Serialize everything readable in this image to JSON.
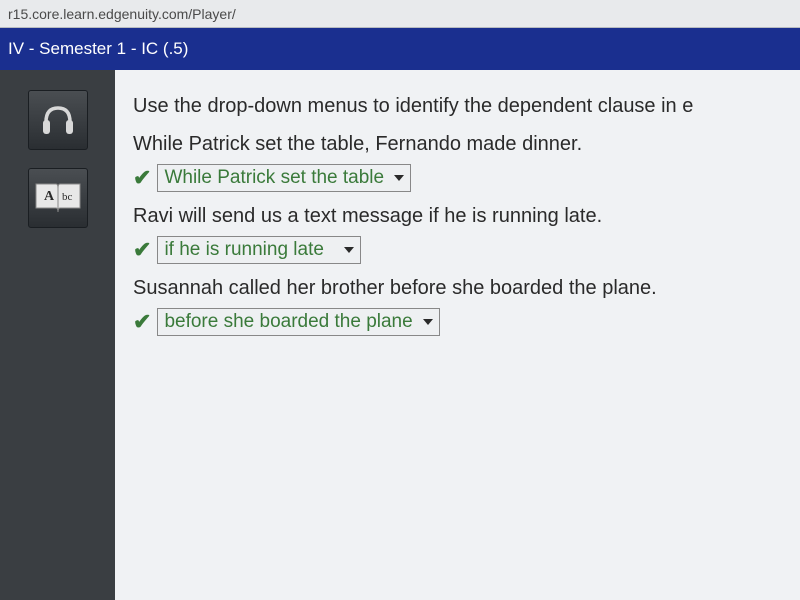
{
  "address_bar": {
    "url": "r15.core.learn.edgenuity.com/Player/"
  },
  "course_header": {
    "title": "IV - Semester 1 - IC (.5)"
  },
  "sidebar": {
    "audio_btn": "headphones-icon",
    "glossary_btn": "glossary-icon"
  },
  "content": {
    "instruction": "Use the drop-down menus to identify the dependent clause in e",
    "questions": [
      {
        "sentence": "While Patrick set the table, Fernando made dinner.",
        "selected": "While Patrick set the table",
        "correct": true
      },
      {
        "sentence": "Ravi will send us a text message if he is running late.",
        "selected": "if he is running late",
        "correct": true
      },
      {
        "sentence": "Susannah called her brother before she boarded the plane.",
        "selected": "before she boarded the plane",
        "correct": true
      }
    ]
  }
}
